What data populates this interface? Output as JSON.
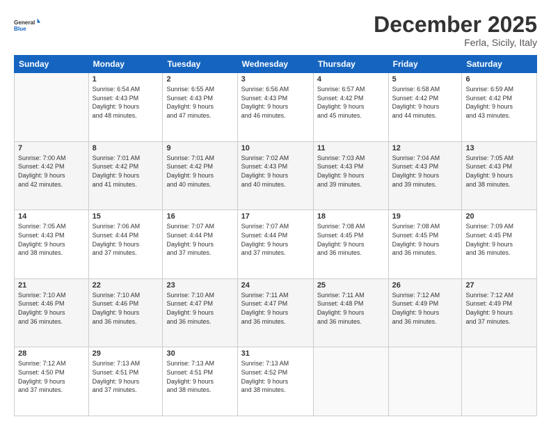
{
  "logo": {
    "line1": "General",
    "line2": "Blue"
  },
  "title": "December 2025",
  "location": "Ferla, Sicily, Italy",
  "headers": [
    "Sunday",
    "Monday",
    "Tuesday",
    "Wednesday",
    "Thursday",
    "Friday",
    "Saturday"
  ],
  "weeks": [
    [
      {
        "day": "",
        "info": ""
      },
      {
        "day": "1",
        "info": "Sunrise: 6:54 AM\nSunset: 4:43 PM\nDaylight: 9 hours\nand 48 minutes."
      },
      {
        "day": "2",
        "info": "Sunrise: 6:55 AM\nSunset: 4:43 PM\nDaylight: 9 hours\nand 47 minutes."
      },
      {
        "day": "3",
        "info": "Sunrise: 6:56 AM\nSunset: 4:43 PM\nDaylight: 9 hours\nand 46 minutes."
      },
      {
        "day": "4",
        "info": "Sunrise: 6:57 AM\nSunset: 4:42 PM\nDaylight: 9 hours\nand 45 minutes."
      },
      {
        "day": "5",
        "info": "Sunrise: 6:58 AM\nSunset: 4:42 PM\nDaylight: 9 hours\nand 44 minutes."
      },
      {
        "day": "6",
        "info": "Sunrise: 6:59 AM\nSunset: 4:42 PM\nDaylight: 9 hours\nand 43 minutes."
      }
    ],
    [
      {
        "day": "7",
        "info": "Sunrise: 7:00 AM\nSunset: 4:42 PM\nDaylight: 9 hours\nand 42 minutes."
      },
      {
        "day": "8",
        "info": "Sunrise: 7:01 AM\nSunset: 4:42 PM\nDaylight: 9 hours\nand 41 minutes."
      },
      {
        "day": "9",
        "info": "Sunrise: 7:01 AM\nSunset: 4:42 PM\nDaylight: 9 hours\nand 40 minutes."
      },
      {
        "day": "10",
        "info": "Sunrise: 7:02 AM\nSunset: 4:43 PM\nDaylight: 9 hours\nand 40 minutes."
      },
      {
        "day": "11",
        "info": "Sunrise: 7:03 AM\nSunset: 4:43 PM\nDaylight: 9 hours\nand 39 minutes."
      },
      {
        "day": "12",
        "info": "Sunrise: 7:04 AM\nSunset: 4:43 PM\nDaylight: 9 hours\nand 39 minutes."
      },
      {
        "day": "13",
        "info": "Sunrise: 7:05 AM\nSunset: 4:43 PM\nDaylight: 9 hours\nand 38 minutes."
      }
    ],
    [
      {
        "day": "14",
        "info": "Sunrise: 7:05 AM\nSunset: 4:43 PM\nDaylight: 9 hours\nand 38 minutes."
      },
      {
        "day": "15",
        "info": "Sunrise: 7:06 AM\nSunset: 4:44 PM\nDaylight: 9 hours\nand 37 minutes."
      },
      {
        "day": "16",
        "info": "Sunrise: 7:07 AM\nSunset: 4:44 PM\nDaylight: 9 hours\nand 37 minutes."
      },
      {
        "day": "17",
        "info": "Sunrise: 7:07 AM\nSunset: 4:44 PM\nDaylight: 9 hours\nand 37 minutes."
      },
      {
        "day": "18",
        "info": "Sunrise: 7:08 AM\nSunset: 4:45 PM\nDaylight: 9 hours\nand 36 minutes."
      },
      {
        "day": "19",
        "info": "Sunrise: 7:08 AM\nSunset: 4:45 PM\nDaylight: 9 hours\nand 36 minutes."
      },
      {
        "day": "20",
        "info": "Sunrise: 7:09 AM\nSunset: 4:45 PM\nDaylight: 9 hours\nand 36 minutes."
      }
    ],
    [
      {
        "day": "21",
        "info": "Sunrise: 7:10 AM\nSunset: 4:46 PM\nDaylight: 9 hours\nand 36 minutes."
      },
      {
        "day": "22",
        "info": "Sunrise: 7:10 AM\nSunset: 4:46 PM\nDaylight: 9 hours\nand 36 minutes."
      },
      {
        "day": "23",
        "info": "Sunrise: 7:10 AM\nSunset: 4:47 PM\nDaylight: 9 hours\nand 36 minutes."
      },
      {
        "day": "24",
        "info": "Sunrise: 7:11 AM\nSunset: 4:47 PM\nDaylight: 9 hours\nand 36 minutes."
      },
      {
        "day": "25",
        "info": "Sunrise: 7:11 AM\nSunset: 4:48 PM\nDaylight: 9 hours\nand 36 minutes."
      },
      {
        "day": "26",
        "info": "Sunrise: 7:12 AM\nSunset: 4:49 PM\nDaylight: 9 hours\nand 36 minutes."
      },
      {
        "day": "27",
        "info": "Sunrise: 7:12 AM\nSunset: 4:49 PM\nDaylight: 9 hours\nand 37 minutes."
      }
    ],
    [
      {
        "day": "28",
        "info": "Sunrise: 7:12 AM\nSunset: 4:50 PM\nDaylight: 9 hours\nand 37 minutes."
      },
      {
        "day": "29",
        "info": "Sunrise: 7:13 AM\nSunset: 4:51 PM\nDaylight: 9 hours\nand 37 minutes."
      },
      {
        "day": "30",
        "info": "Sunrise: 7:13 AM\nSunset: 4:51 PM\nDaylight: 9 hours\nand 38 minutes."
      },
      {
        "day": "31",
        "info": "Sunrise: 7:13 AM\nSunset: 4:52 PM\nDaylight: 9 hours\nand 38 minutes."
      },
      {
        "day": "",
        "info": ""
      },
      {
        "day": "",
        "info": ""
      },
      {
        "day": "",
        "info": ""
      }
    ]
  ]
}
